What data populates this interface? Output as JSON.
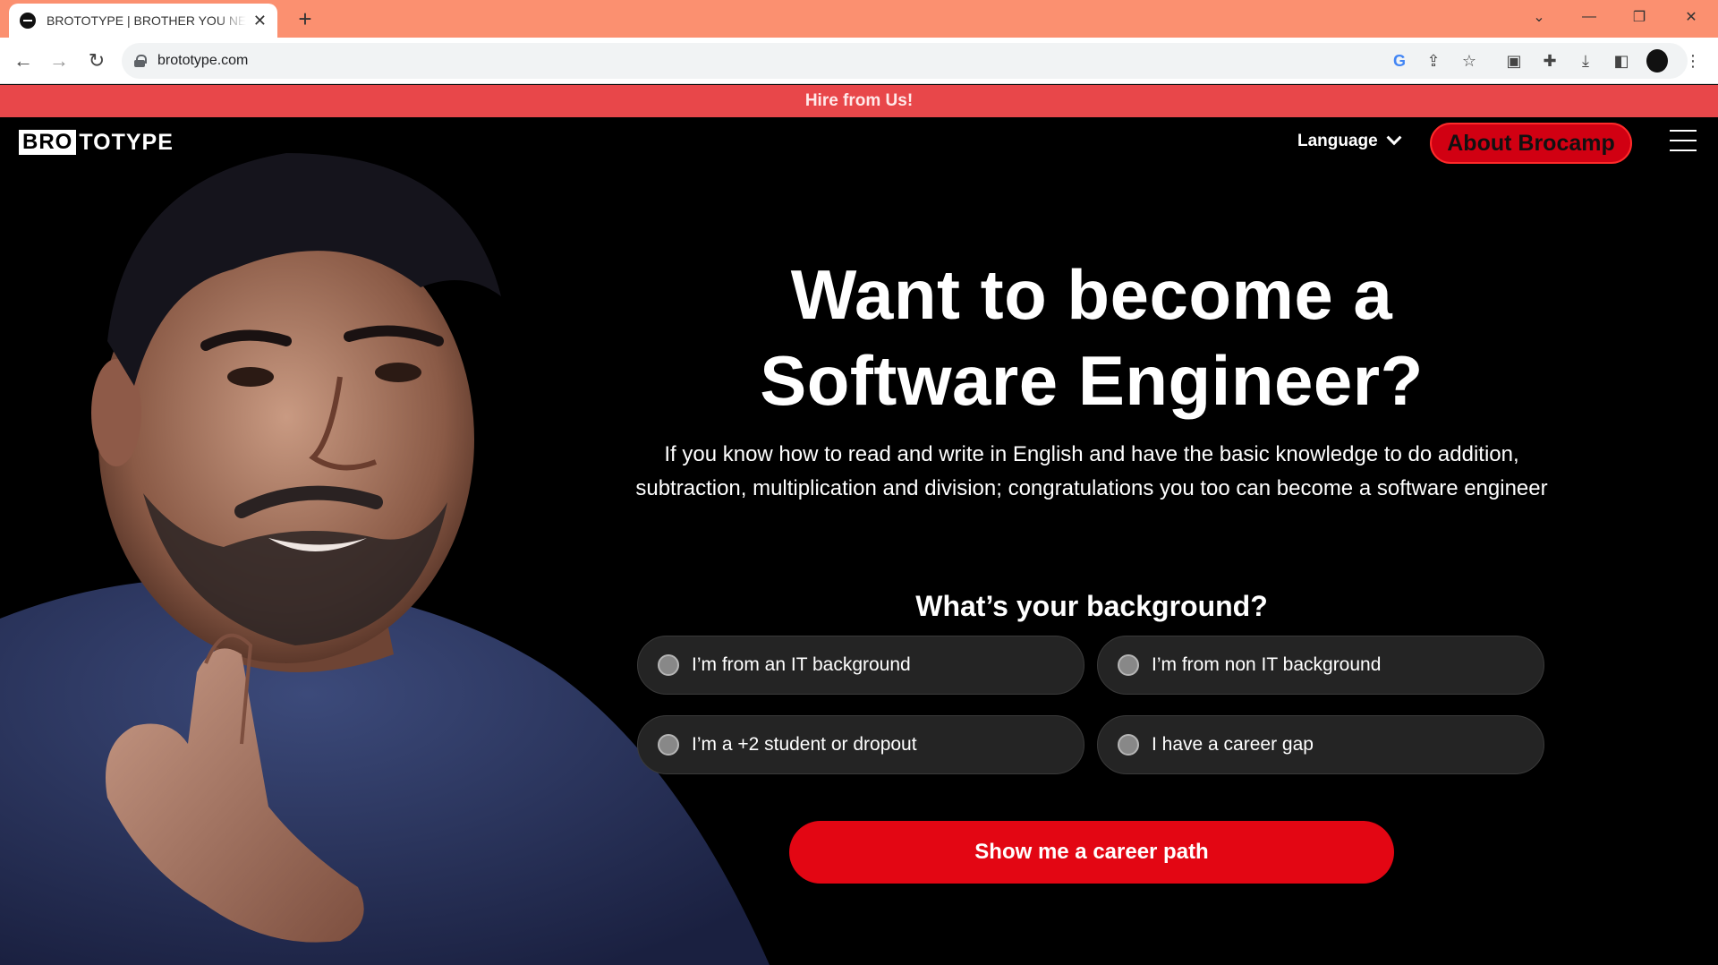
{
  "browser": {
    "tab_title": "BROTOTYPE | BROTHER YOU NEVER HAD",
    "url": "brototype.com"
  },
  "banner": {
    "text": "Hire from Us!"
  },
  "nav": {
    "logo_part1": "BRO",
    "logo_part2": "TOTYPE",
    "language_label": "Language",
    "about_button": "About Brocamp"
  },
  "hero": {
    "heading_line1": "Want to become a",
    "heading_line2": "Software Engineer?",
    "description": "If you know how to read and write in English and have the basic knowledge to do addition, subtraction, multiplication and division; congratulations you too can become a software engineer"
  },
  "background_question": {
    "title": "What’s your background?",
    "options": [
      "I’m from an IT background",
      "I’m from non IT background",
      "I’m a +2 student or dropout",
      "I have a career gap"
    ]
  },
  "cta": {
    "label": "Show me a career path"
  },
  "colors": {
    "tabstrip": "#fb9070",
    "banner": "#e8474a",
    "accent_red": "#e30613",
    "about_button": "#d10012"
  }
}
